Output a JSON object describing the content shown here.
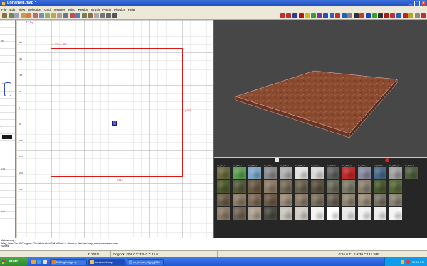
{
  "window": {
    "title": "unnamed.map *"
  },
  "menu": [
    "File",
    "Edit",
    "View",
    "Selection",
    "Grid",
    "Textures",
    "Misc",
    "Region",
    "Brush",
    "Patch",
    "Physics",
    "Help"
  ],
  "toolbar": {
    "left_colors": [
      "#8a7040",
      "#6a8a50",
      "#9aa0c0",
      "#c0a050",
      "#d88040",
      "#c06a6a",
      "#7090c0",
      "#90b070",
      "#d0a040",
      "#a0a0a0",
      "#707090",
      "#c05050",
      "#5080c0",
      "#708060",
      "#9a6a40",
      "#aaa",
      "#777",
      "#666",
      "#555"
    ],
    "right_colors": [
      "#c03030",
      "#c03030",
      "#2040a0",
      "#c01010",
      "#c0c020",
      "#30a030",
      "#8030a0",
      "#2050b0",
      "#3060c0",
      "#c03030",
      "#2060c0",
      "#808080",
      "#303030",
      "#c04030",
      "#2040c0",
      "#30a030",
      "#303030",
      "#a02020",
      "#c03030",
      "#2060c0",
      "#c02020",
      "#c0a020",
      "#8a8a8a",
      "#c03030"
    ]
  },
  "grid_view": {
    "view_label": "XY Top",
    "dim_top": "x:-170  y:-350",
    "dim_right": "y:351",
    "dim_bottom": "x:512",
    "y_labels": [
      "256",
      "192",
      "128",
      "64",
      "0",
      "-64",
      "-128",
      "-192",
      "-256",
      "-320"
    ],
    "left_labels": [
      "256",
      "128",
      "0",
      "-128",
      "-256"
    ]
  },
  "texture_browser": {
    "row1_labels": [
      "ch_gun_1",
      "ch_ganc_1",
      "ch_gnat_1",
      "ch_gnatt_1",
      "ch_gnatt_2",
      "ch_gnatt_3",
      "ch_gnatt_4",
      "ch_gnatt_5",
      "ch_gnatt_6",
      "ch_gnatt_7",
      "ch_gnatt_8",
      "ch_gnatt_9",
      "ch_gnatt_a"
    ],
    "row1_colors": [
      "#6a6a40",
      "#5aa050",
      "#7ea8c8",
      "#8a8a8a",
      "#b0b0b0",
      "#e0e0e0",
      "#d8d8d8",
      "#606060",
      "#c02a2a",
      "#8a8aa0",
      "#4a6a8a",
      "#a0a0a0",
      "#506040"
    ],
    "row2_colors": [
      "#4e5a2e",
      "#555a3a",
      "#6a5a44",
      "#8a7a66",
      "#756a58",
      "#6a604e",
      "#5a5040",
      "#6a6a5a",
      "#7a7a6a",
      "#8a8070",
      "#4a5a30",
      "#56683a"
    ],
    "row3_colors": [
      "#6a5c48",
      "#8a7a66",
      "#7a6a56",
      "#6a5a48",
      "#9a8a78",
      "#8a7a6a",
      "#7a7060",
      "#686052",
      "#8e8472",
      "#9a8e7a",
      "#7a7264",
      "#8a8272"
    ],
    "row4_colors": [
      "#8a7a68",
      "#6e6254",
      "#aaa090",
      "#4a4a44",
      "#c8c4bc",
      "#d0ccc4",
      "#f2f2f2",
      "#ffffff",
      "#e8e8e8",
      "#f0f0f0",
      "#ececec",
      "#f4f4f4"
    ]
  },
  "console": {
    "lines": [
      "Autosaving...",
      "Map_SaveFile: C:/Program Files/Activision/Call of Duty 4 - Modern Warfare/map_source/autosave.map",
      "Saved."
    ]
  },
  "status": {
    "z": "Z: 208.0",
    "origin": "Origin X: -256.0  Y: 320.0  Z: 16.0",
    "grid": "G:16.0 T:1.0 R:30 C:13 L:MR"
  },
  "taskbar": {
    "start": "start",
    "tasks": [
      "Editing image /p",
      "unnamed.map",
      "cp_terrain_1.jpg (360"
    ],
    "clock": "12:36 PM"
  },
  "colors": {
    "brush": "#d41a1a",
    "terrain": "#8a4a30",
    "camera_bg": "#474747",
    "title_blue": "#2456d0"
  }
}
